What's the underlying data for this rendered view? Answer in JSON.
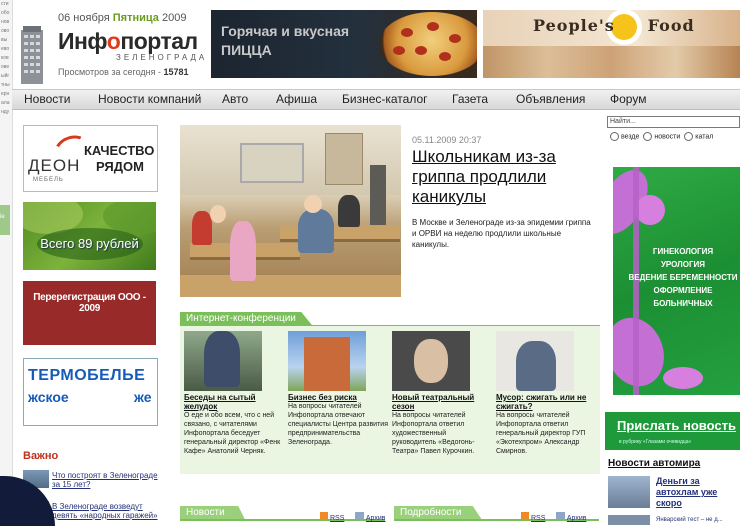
{
  "strip": [
    "сти",
    "обо",
    "нов",
    "ово",
    "вы",
    "ево",
    "ков",
    "ове",
    "ыйг",
    "тны",
    "ерн",
    "ала",
    "нду"
  ],
  "strip_badge": "ie",
  "header": {
    "date_prefix": "06 ноября",
    "weekday": "Пятница",
    "year": "2009",
    "logo_left": "Инф",
    "logo_o": "о",
    "logo_right": "портал",
    "logo_sub": "ЗЕЛЕНОГРАДА",
    "views_label": "Просмотров за сегодня -",
    "views_count": "15781"
  },
  "banners": {
    "pizza_line1": "Горячая и вкусная",
    "pizza_line2": "ПИЦЦА",
    "food_title": "People's     Food"
  },
  "nav": [
    "Новости",
    "Новости компаний",
    "Авто",
    "Афиша",
    "Бизнес-каталог",
    "Газета",
    "Объявления",
    "Форум"
  ],
  "ads": {
    "deon_slogan1": "КАЧЕСТВО",
    "deon_slogan2": "РЯДОМ",
    "deon_brand": "ДЕОН",
    "deon_brand_sub": "МЕБЕЛЬ",
    "price": "Всего 89 рублей",
    "registration": "Перерегистрация ООО - 2009",
    "thermo1": "ТЕРМОБЕЛЬЕ",
    "thermo2": "жское",
    "thermo3": "же"
  },
  "important": {
    "heading": "Важно",
    "items": [
      "Что построят в Зеленограде за 15 лет?",
      "В Зеленограде возведут девять «народных гаражей»"
    ]
  },
  "article": {
    "date": "05.11.2009 20:37",
    "title": "Школьникам из-за гриппа продлили каникулы",
    "body": "В Москве и Зеленограде из-за эпидемии гриппа и ОРВИ на неделю продлили школьные каникулы."
  },
  "conferences": {
    "tab": "Интернет-конференции",
    "items": [
      {
        "title": "Беседы на сытый желудок",
        "text": "О еде и обо всем, что с ней связано, с читателями Инфопортала беседует генеральный директор «Фенк Кафе» Анатолий Черняк."
      },
      {
        "title": "Бизнес без риска",
        "text": "На вопросы читателей Инфопортала отвечают специалисты Центра развития предпринимательства Зеленограда."
      },
      {
        "title": "Новый театральный сезон",
        "text": "На вопросы читателей Инфопортала ответил художественный руководитель «Ведогонь-Театра» Павел Курочкин."
      },
      {
        "title": "Мусор: сжигать или не сжигать?",
        "text": "На вопросы читателей Инфопортала ответил генеральный директор ГУП «Экотехпром» Александр Смирнов."
      }
    ]
  },
  "bottom_tabs": {
    "news": "Новости",
    "details": "Подробности",
    "rss": "RSS",
    "archive": "Архив"
  },
  "sidebar": {
    "search_value": "Найти...",
    "radio_options": [
      "везде",
      "новости",
      "катал"
    ],
    "gyn_lines": [
      "ГИНЕКОЛОГИЯ",
      "УРОЛОГИЯ",
      "ВЕДЕНИЕ БЕРЕМЕННОСТИ",
      "ОФОРМЛЕНИЕ",
      "БОЛЬНИЧНЫХ"
    ],
    "send_news": "Прислать новость",
    "send_sub": "в рубрику «Глазами очевидца»",
    "auto_heading": "Новости автомира",
    "auto_link1": "Деньги за автохлам уже скоро",
    "auto_link2": "Январский тест – не д..."
  }
}
